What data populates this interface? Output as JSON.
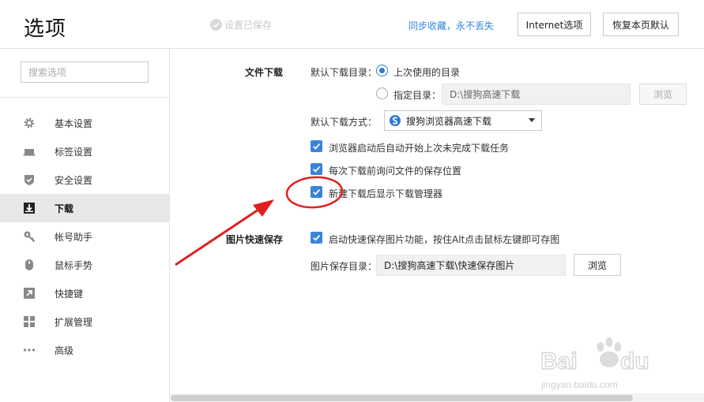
{
  "header": {
    "title": "选项",
    "saved_status": "设置已保存",
    "sync_link": "同步收藏，永不丢失",
    "internet_options_label": "Internet选项",
    "restore_defaults_label": "恢复本页默认"
  },
  "sidebar": {
    "search_placeholder": "搜索选项",
    "items": [
      {
        "label": "基本设置",
        "icon": "gear-icon"
      },
      {
        "label": "标签设置",
        "icon": "tab-icon"
      },
      {
        "label": "安全设置",
        "icon": "shield-check-icon"
      },
      {
        "label": "下载",
        "icon": "download-icon",
        "active": true
      },
      {
        "label": "帐号助手",
        "icon": "key-icon"
      },
      {
        "label": "鼠标手势",
        "icon": "mouse-icon"
      },
      {
        "label": "快捷键",
        "icon": "shortcut-arrow-icon"
      },
      {
        "label": "扩展管理",
        "icon": "extensions-grid-icon"
      },
      {
        "label": "高级",
        "icon": "more-dots-icon"
      }
    ]
  },
  "download": {
    "section_title": "文件下载",
    "default_dir_label": "默认下载目录：",
    "radio_last_used": "上次使用的目录",
    "radio_specified": "指定目录：",
    "specified_dir_value": "D:\\搜狗高速下载",
    "browse_label": "浏览",
    "default_method_label": "默认下载方式：",
    "default_method_value": "搜狗浏览器高速下载",
    "options": [
      {
        "label": "浏览器启动后自动开始上次未完成下载任务",
        "checked": true
      },
      {
        "label": "每次下载前询问文件的保存位置",
        "checked": true
      },
      {
        "label": "新建下载后显示下载管理器",
        "checked": true
      }
    ]
  },
  "image_save": {
    "section_title": "图片快速保存",
    "enable_label": "启动快速保存图片功能，按住Alt点击鼠标左键即可存图",
    "enable_checked": true,
    "dir_label": "图片保存目录：",
    "dir_value": "D:\\搜狗高速下载\\快速保存图片",
    "browse_label": "浏览"
  },
  "colors": {
    "accent": "#3a84d8",
    "link": "#2e86d8",
    "annotation": "#e02020"
  }
}
